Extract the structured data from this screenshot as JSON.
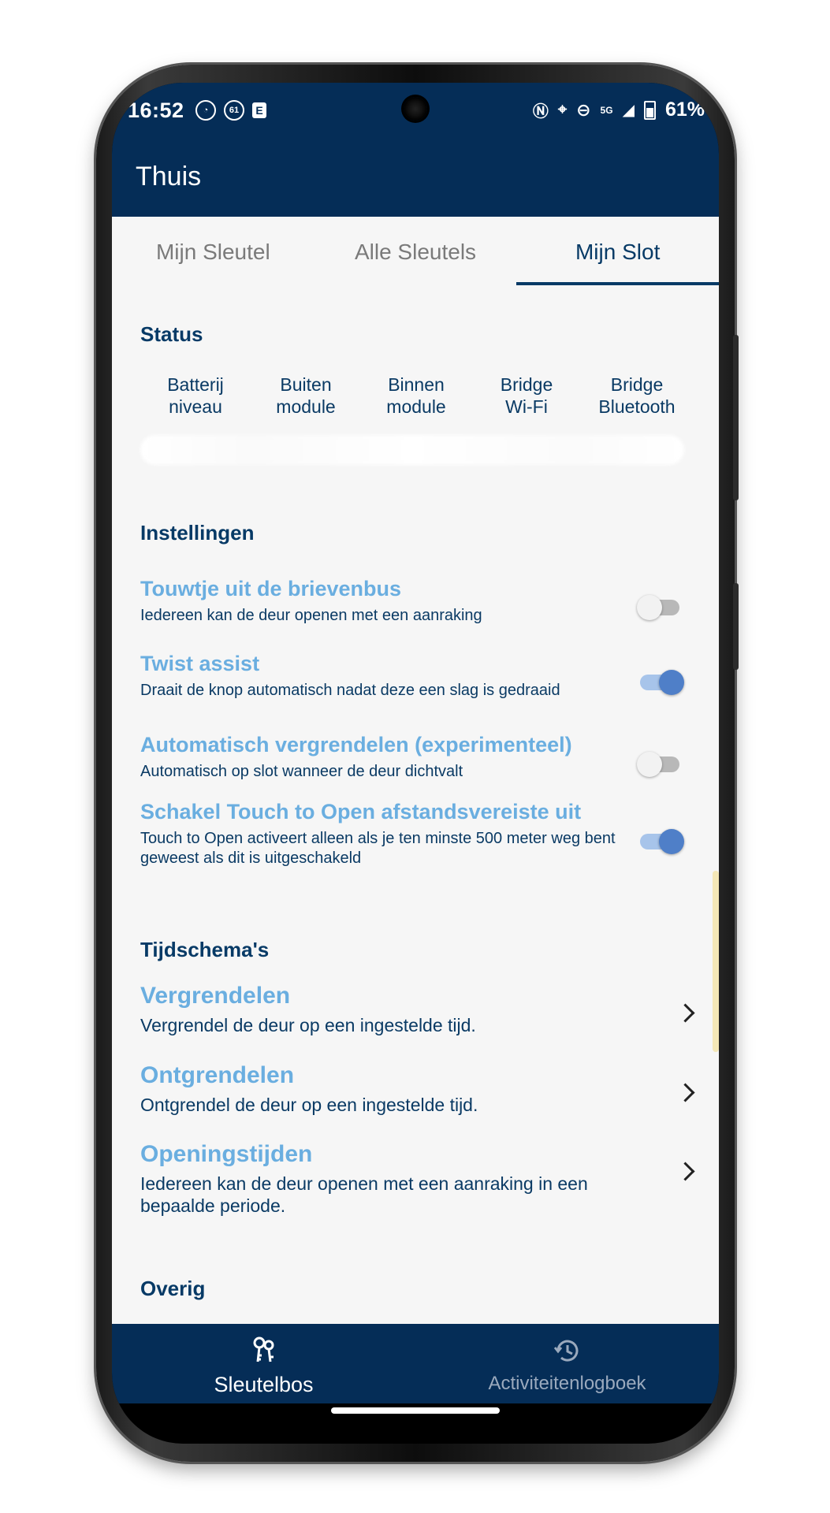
{
  "status_bar": {
    "time": "16:52",
    "notif_icons": [
      "sync-icon",
      "61-badge-icon",
      "e-icon"
    ],
    "right_icons": [
      "nfc-icon",
      "location-icon",
      "dnd-icon",
      "signal-5g-icon",
      "battery-icon"
    ],
    "network": "5G",
    "battery": "61%"
  },
  "app_bar": {
    "title": "Thuis"
  },
  "tabs": [
    {
      "label": "Mijn Sleutel",
      "active": false
    },
    {
      "label": "Alle Sleutels",
      "active": false
    },
    {
      "label": "Mijn Slot",
      "active": true
    }
  ],
  "status_section": {
    "title": "Status",
    "columns": [
      {
        "line1": "Batterij",
        "line2": "niveau"
      },
      {
        "line1": "Buiten",
        "line2": "module"
      },
      {
        "line1": "Binnen",
        "line2": "module"
      },
      {
        "line1": "Bridge",
        "line2": "Wi-Fi"
      },
      {
        "line1": "Bridge",
        "line2": "Bluetooth"
      }
    ]
  },
  "settings_section": {
    "title": "Instellingen",
    "items": [
      {
        "title": "Touwtje uit de brievenbus",
        "desc": "Iedereen kan de deur openen met een aanraking",
        "enabled": false
      },
      {
        "title": "Twist assist",
        "desc": "Draait de knop automatisch nadat deze een slag is gedraaid",
        "enabled": true
      },
      {
        "title": "Automatisch vergrendelen (experimenteel)",
        "desc": "Automatisch op slot wanneer de deur dichtvalt",
        "enabled": false
      },
      {
        "title": "Schakel Touch to Open afstandsvereiste uit",
        "desc": "Touch to Open activeert alleen als je ten minste 500 meter weg bent geweest als dit is uitgeschakeld",
        "enabled": true
      }
    ]
  },
  "schedules_section": {
    "title": "Tijdschema's",
    "items": [
      {
        "title": "Vergrendelen",
        "desc": "Vergrendel de deur op een ingestelde tijd."
      },
      {
        "title": "Ontgrendelen",
        "desc": "Ontgrendel de deur op een ingestelde tijd."
      },
      {
        "title": "Openingstijden",
        "desc": "Iedereen kan de deur openen met een aanraking in een bepaalde periode."
      }
    ]
  },
  "other_section": {
    "title": "Overig"
  },
  "bottom_nav": [
    {
      "label": "Sleutelbos",
      "icon": "keys-icon",
      "active": true
    },
    {
      "label": "Activiteitenlogboek",
      "icon": "history-icon",
      "active": false
    }
  ],
  "colors": {
    "primary_dark": "#052d57",
    "accent_blue": "#6aaee0",
    "toggle_on": "#4f7fc8",
    "background": "#f6f6f6"
  }
}
